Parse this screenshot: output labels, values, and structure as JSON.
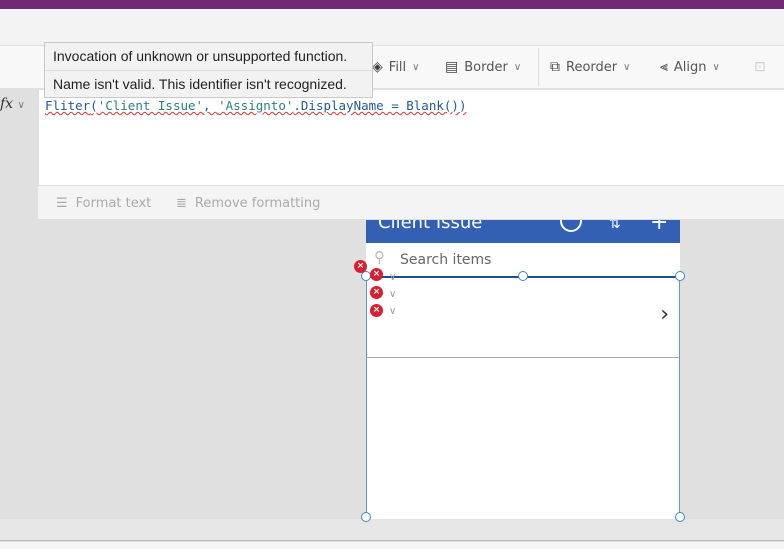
{
  "tooltip": {
    "line1": "Invocation of unknown or unsupported function.",
    "line2": "Name isn't valid. This identifier isn't recognized."
  },
  "toolbar": {
    "fill": "Fill",
    "border": "Border",
    "reorder": "Reorder",
    "align": "Align"
  },
  "formula": {
    "fx": "fx",
    "fn": "Fliter",
    "arg1": "'Client Issue'",
    "arg2": "'Assignto'",
    "rest": ".DisplayName = Blank())"
  },
  "format": {
    "format_text": "Format text",
    "remove_formatting": "Remove formatting"
  },
  "screen": {
    "title": "Client Issue",
    "search_placeholder": "Search items"
  },
  "colors": {
    "brand": "#742774",
    "header": "#3460b4",
    "error": "#d91f2f"
  }
}
